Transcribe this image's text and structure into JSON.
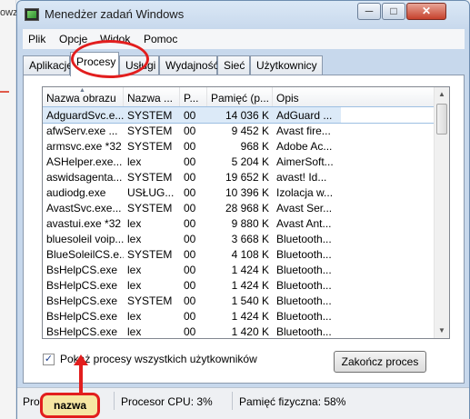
{
  "background": {
    "left_fragment": "owz"
  },
  "window": {
    "title": "Menedżer zadań Windows",
    "close_label": "✕",
    "minimize_label": "─",
    "maximize_label": "□"
  },
  "menubar": {
    "items": [
      "Plik",
      "Opcje",
      "Widok",
      "Pomoc"
    ]
  },
  "tabs": {
    "items": [
      "Aplikacje",
      "Procesy",
      "Usługi",
      "Wydajność",
      "Sieć",
      "Użytkownicy"
    ],
    "active": "Procesy"
  },
  "table": {
    "columns": [
      "Nazwa obrazu",
      "Nazwa ...",
      "P...",
      "Pamięć (p...",
      "Opis"
    ],
    "rows": [
      {
        "image": "AdguardSvc.e...",
        "user": "SYSTEM",
        "cpu": "00",
        "memory": "14 036 K",
        "desc": "AdGuard ..."
      },
      {
        "image": "afwServ.exe ...",
        "user": "SYSTEM",
        "cpu": "00",
        "memory": "9 452 K",
        "desc": "Avast fire..."
      },
      {
        "image": "armsvc.exe *32",
        "user": "SYSTEM",
        "cpu": "00",
        "memory": "968 K",
        "desc": "Adobe Ac..."
      },
      {
        "image": "ASHelper.exe...",
        "user": "lex",
        "cpu": "00",
        "memory": "5 204 K",
        "desc": "AimerSoft..."
      },
      {
        "image": "aswidsagenta...",
        "user": "SYSTEM",
        "cpu": "00",
        "memory": "19 652 K",
        "desc": "avast! Id..."
      },
      {
        "image": "audiodg.exe",
        "user": "USŁUG...",
        "cpu": "00",
        "memory": "10 396 K",
        "desc": "Izolacja w..."
      },
      {
        "image": "AvastSvc.exe...",
        "user": "SYSTEM",
        "cpu": "00",
        "memory": "28 968 K",
        "desc": "Avast Ser..."
      },
      {
        "image": "avastui.exe *32",
        "user": "lex",
        "cpu": "00",
        "memory": "9 880 K",
        "desc": "Avast Ant..."
      },
      {
        "image": "bluesoleil voip...",
        "user": "lex",
        "cpu": "00",
        "memory": "3 668 K",
        "desc": "Bluetooth..."
      },
      {
        "image": "BlueSoleilCS.e...",
        "user": "SYSTEM",
        "cpu": "00",
        "memory": "4 108 K",
        "desc": "Bluetooth..."
      },
      {
        "image": "BsHelpCS.exe",
        "user": "lex",
        "cpu": "00",
        "memory": "1 424 K",
        "desc": "Bluetooth..."
      },
      {
        "image": "BsHelpCS.exe",
        "user": "lex",
        "cpu": "00",
        "memory": "1 424 K",
        "desc": "Bluetooth..."
      },
      {
        "image": "BsHelpCS.exe",
        "user": "SYSTEM",
        "cpu": "00",
        "memory": "1 540 K",
        "desc": "Bluetooth..."
      },
      {
        "image": "BsHelpCS.exe",
        "user": "lex",
        "cpu": "00",
        "memory": "1 424 K",
        "desc": "Bluetooth..."
      },
      {
        "image": "BsHelpCS.exe",
        "user": "lex",
        "cpu": "00",
        "memory": "1 420 K",
        "desc": "Bluetooth..."
      }
    ]
  },
  "controls": {
    "show_all_label": "Pokaż procesy wszystkich użytkowników",
    "show_all_checked": true,
    "end_process_label": "Zakończ proces"
  },
  "statusbar": {
    "processes": "Proce",
    "cpu": "Procesor CPU: 3%",
    "memory": "Pamięć fizyczna: 58%"
  },
  "annotation": {
    "callout_text": "nazwa",
    "color": "#e21e1e"
  }
}
